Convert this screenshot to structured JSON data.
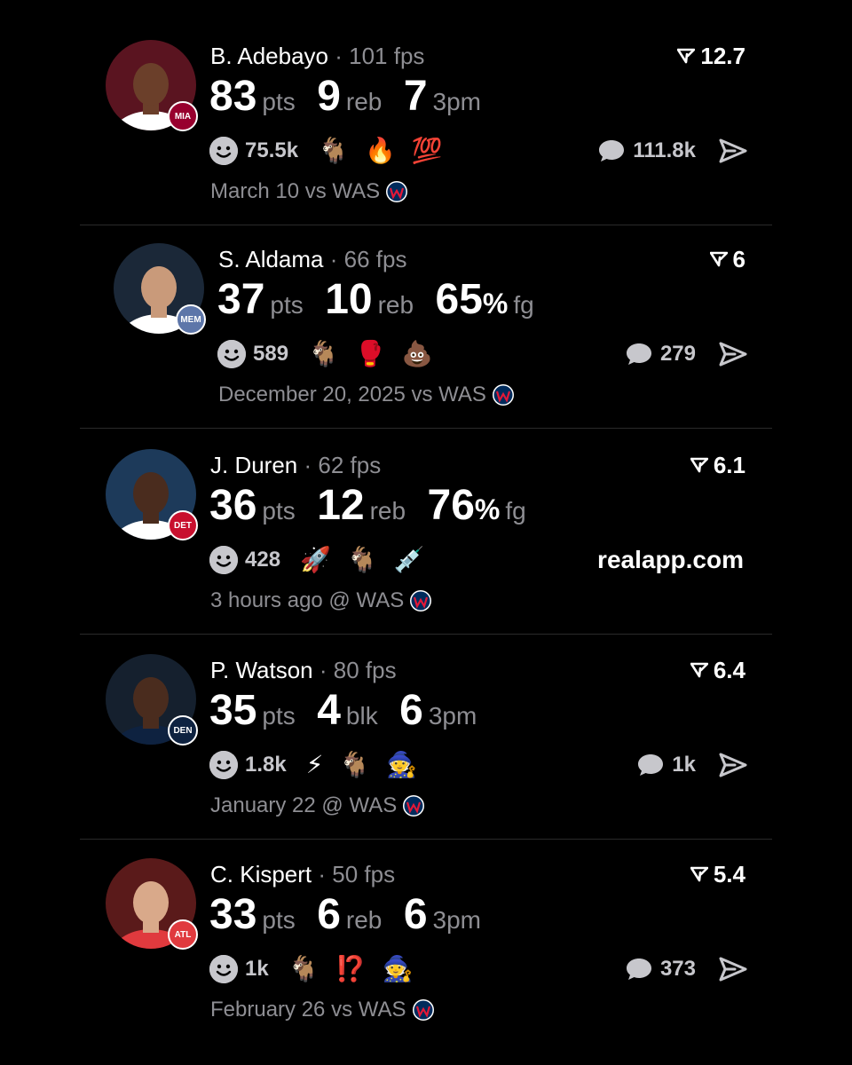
{
  "colors": {
    "background": "#000000",
    "text": "#ffffff",
    "muted": "#8e8e93",
    "divider": "#2a2a2a"
  },
  "watermark": "realapp.com",
  "cards": [
    {
      "name": "B. Adebayo",
      "fps": "· 101 fps",
      "rating": "12.7",
      "stats": [
        {
          "value": "83",
          "pct": "",
          "unit": "pts"
        },
        {
          "value": "9",
          "pct": "",
          "unit": "reb"
        },
        {
          "value": "7",
          "pct": "",
          "unit": "3pm"
        }
      ],
      "reactions_count": "75.5k",
      "emojis": [
        "🐐",
        "🔥",
        "💯"
      ],
      "comments": "111.8k",
      "date": "March 10 vs WAS",
      "avatar_bg": "#5a1420",
      "team": "MIA",
      "team_color": "#98002e",
      "skin": "#6b3f2a",
      "jersey": "#ffffff"
    },
    {
      "name": "S. Aldama",
      "fps": "· 66 fps",
      "rating": "6",
      "stats": [
        {
          "value": "37",
          "pct": "",
          "unit": "pts"
        },
        {
          "value": "10",
          "pct": "",
          "unit": "reb"
        },
        {
          "value": "65",
          "pct": "%",
          "unit": "fg"
        }
      ],
      "reactions_count": "589",
      "emojis": [
        "🐐",
        "🥊",
        "💩"
      ],
      "comments": "279",
      "date": "December 20, 2025 vs WAS",
      "avatar_bg": "#1b2838",
      "team": "MEM",
      "team_color": "#5d76a9",
      "skin": "#c99a7a",
      "jersey": "#ffffff"
    },
    {
      "name": "J. Duren",
      "fps": "· 62 fps",
      "rating": "6.1",
      "stats": [
        {
          "value": "36",
          "pct": "",
          "unit": "pts"
        },
        {
          "value": "12",
          "pct": "",
          "unit": "reb"
        },
        {
          "value": "76",
          "pct": "%",
          "unit": "fg"
        }
      ],
      "reactions_count": "428",
      "emojis": [
        "🚀",
        "🐐",
        "💉"
      ],
      "comments": "",
      "date": "3 hours ago @ WAS",
      "avatar_bg": "#1d3a5a",
      "team": "DET",
      "team_color": "#c8102e",
      "skin": "#4a2c1e",
      "jersey": "#ffffff"
    },
    {
      "name": "P. Watson",
      "fps": "· 80 fps",
      "rating": "6.4",
      "stats": [
        {
          "value": "35",
          "pct": "",
          "unit": "pts"
        },
        {
          "value": "4",
          "pct": "",
          "unit": "blk"
        },
        {
          "value": "6",
          "pct": "",
          "unit": "3pm"
        }
      ],
      "reactions_count": "1.8k",
      "emojis": [
        "⚡",
        "🐐",
        "🧙"
      ],
      "comments": "1k",
      "date": "January 22 @ WAS",
      "avatar_bg": "#15202e",
      "team": "DEN",
      "team_color": "#0e2240",
      "skin": "#4a2c1e",
      "jersey": "#0e2240"
    },
    {
      "name": "C. Kispert",
      "fps": "· 50 fps",
      "rating": "5.4",
      "stats": [
        {
          "value": "33",
          "pct": "",
          "unit": "pts"
        },
        {
          "value": "6",
          "pct": "",
          "unit": "reb"
        },
        {
          "value": "6",
          "pct": "",
          "unit": "3pm"
        }
      ],
      "reactions_count": "1k",
      "emojis": [
        "🐐",
        "⁉️",
        "🧙"
      ],
      "comments": "373",
      "date": "February 26 vs WAS",
      "avatar_bg": "#5a1a1a",
      "team": "ATL",
      "team_color": "#e03a3e",
      "skin": "#d9a98a",
      "jersey": "#e03a3e"
    }
  ]
}
